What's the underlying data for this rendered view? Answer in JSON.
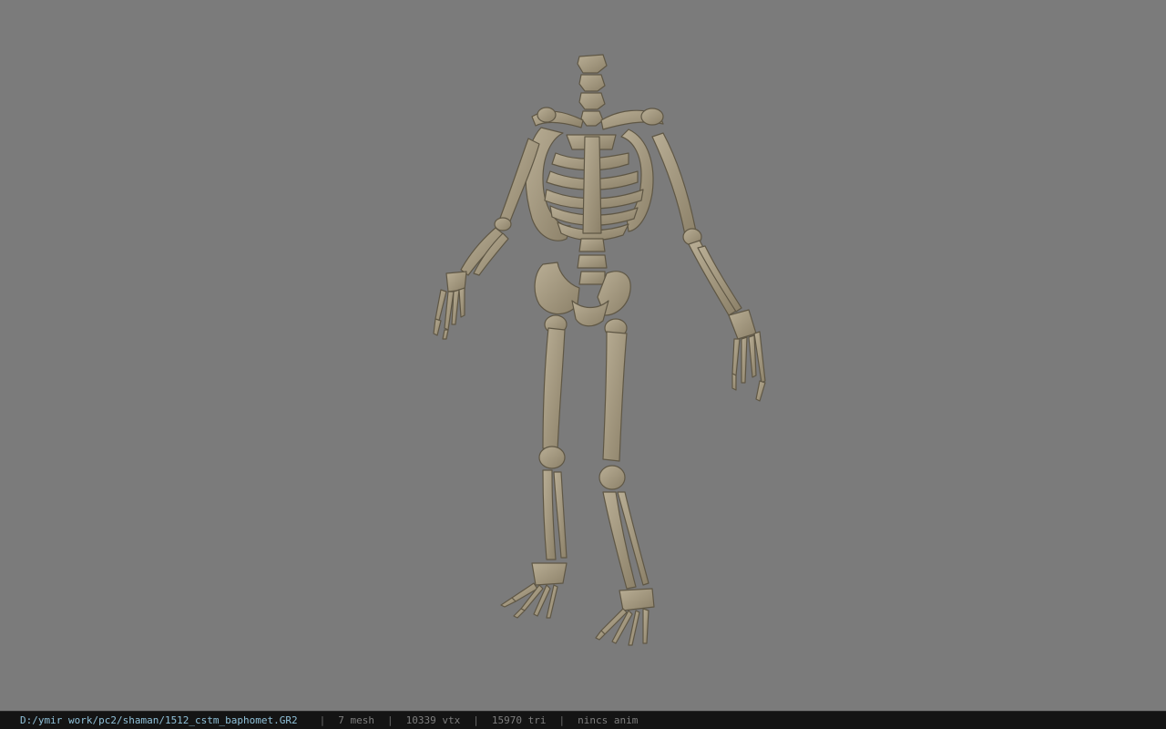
{
  "viewport": {
    "background_color": "#7b7b7b",
    "model_color": "#a79c83",
    "model_shadow_color": "#6f6652",
    "model_name": "skeleton"
  },
  "statusbar": {
    "file_path": "D:/ymir work/pc2/shaman/1512_cstm_baphomet.GR2",
    "mesh_count": "7 mesh",
    "vertex_count": "10339 vtx",
    "triangle_count": "15970 tri",
    "anim_info": "nincs anim",
    "separator": "|"
  }
}
